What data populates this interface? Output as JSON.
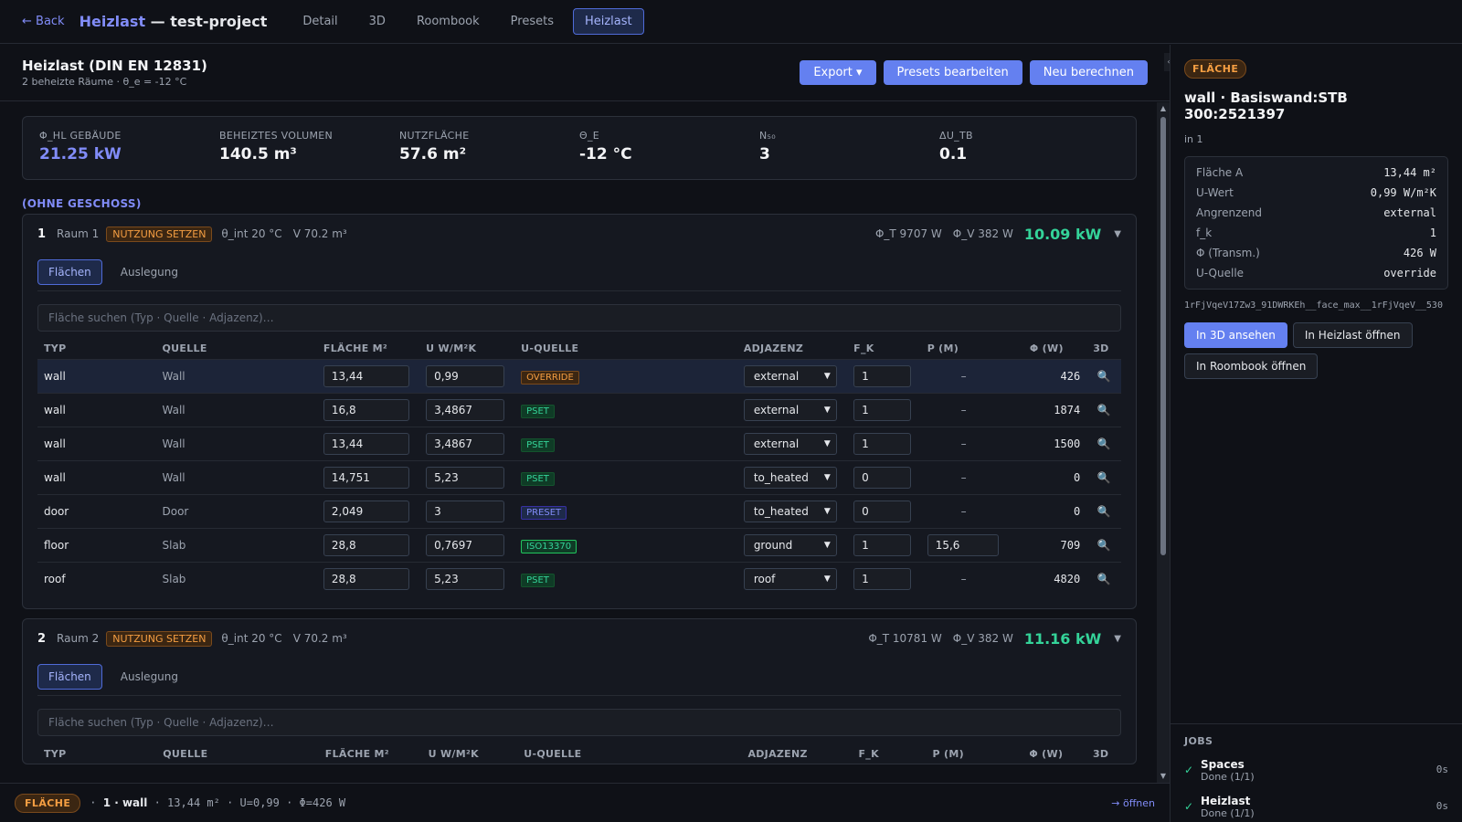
{
  "topbar": {
    "back": "← Back",
    "title_app": "Heizlast",
    "title_sep": " — test-project",
    "tabs": [
      "Detail",
      "3D",
      "Roombook",
      "Presets",
      "Heizlast"
    ],
    "active_tab": "Heizlast"
  },
  "header": {
    "title": "Heizlast (DIN EN 12831)",
    "subtitle": "2 beheizte Räume · θ_e = -12 °C",
    "buttons": {
      "export": "Export ▾",
      "presets": "Presets bearbeiten",
      "recalc": "Neu berechnen"
    }
  },
  "stats": [
    {
      "label": "Φ_HL GEBÄUDE",
      "value": "21.25 kW"
    },
    {
      "label": "BEHEIZTES VOLUMEN",
      "value": "140.5 m³"
    },
    {
      "label": "NUTZFLÄCHE",
      "value": "57.6 m²"
    },
    {
      "label": "Θ_E",
      "value": "-12 °C"
    },
    {
      "label": "N₅₀",
      "value": "3"
    },
    {
      "label": "ΔU_TB",
      "value": "0.1"
    }
  ],
  "section_title": "(OHNE GESCHOSS)",
  "columns": [
    "TYP",
    "QUELLE",
    "FLÄCHE M²",
    "U W/M²K",
    "U-QUELLE",
    "ADJAZENZ",
    "F_K",
    "P (M)",
    "Φ (W)",
    "3D"
  ],
  "rooms": [
    {
      "num": "1",
      "name": "Raum 1",
      "badge": "NUTZUNG SETZEN",
      "theta": "θ_int 20 °C",
      "volume": "V 70.2 m³",
      "phi_t": "Φ_T 9707 W",
      "phi_v": "Φ_V 382 W",
      "total": "10.09 kW",
      "tabs": [
        "Flächen",
        "Auslegung"
      ],
      "search_placeholder": "Fläche suchen (Typ · Quelle · Adjazenz)…",
      "rows": [
        {
          "typ": "wall",
          "quelle": "Wall",
          "flaeche": "13,44",
          "u": "0,99",
          "uquelle": "OVERRIDE",
          "adj": "external",
          "fk": "1",
          "p": "–",
          "phi": "426"
        },
        {
          "typ": "wall",
          "quelle": "Wall",
          "flaeche": "16,8",
          "u": "3,4867",
          "uquelle": "PSET",
          "adj": "external",
          "fk": "1",
          "p": "–",
          "phi": "1874"
        },
        {
          "typ": "wall",
          "quelle": "Wall",
          "flaeche": "13,44",
          "u": "3,4867",
          "uquelle": "PSET",
          "adj": "external",
          "fk": "1",
          "p": "–",
          "phi": "1500"
        },
        {
          "typ": "wall",
          "quelle": "Wall",
          "flaeche": "14,751",
          "u": "5,23",
          "uquelle": "PSET",
          "adj": "to_heated",
          "fk": "0",
          "p": "–",
          "phi": "0"
        },
        {
          "typ": "door",
          "quelle": "Door",
          "flaeche": "2,049",
          "u": "3",
          "uquelle": "PRESET",
          "adj": "to_heated",
          "fk": "0",
          "p": "–",
          "phi": "0"
        },
        {
          "typ": "floor",
          "quelle": "Slab",
          "flaeche": "28,8",
          "u": "0,7697",
          "uquelle": "ISO13370",
          "adj": "ground",
          "fk": "1",
          "p": "15,6",
          "phi": "709"
        },
        {
          "typ": "roof",
          "quelle": "Slab",
          "flaeche": "28,8",
          "u": "5,23",
          "uquelle": "PSET",
          "adj": "roof",
          "fk": "1",
          "p": "–",
          "phi": "4820"
        }
      ]
    },
    {
      "num": "2",
      "name": "Raum 2",
      "badge": "NUTZUNG SETZEN",
      "theta": "θ_int 20 °C",
      "volume": "V 70.2 m³",
      "phi_t": "Φ_T 10781 W",
      "phi_v": "Φ_V 382 W",
      "total": "11.16 kW",
      "tabs": [
        "Flächen",
        "Auslegung"
      ],
      "search_placeholder": "Fläche suchen (Typ · Quelle · Adjazenz)…"
    }
  ],
  "panel": {
    "badge": "FLÄCHE",
    "title": "wall · Basiswand:STB 300:2521397",
    "sub": "in 1",
    "kv": [
      {
        "k": "Fläche A",
        "v": "13,44 m²"
      },
      {
        "k": "U-Wert",
        "v": "0,99 W/m²K"
      },
      {
        "k": "Angrenzend",
        "v": "external"
      },
      {
        "k": "f_k",
        "v": "1"
      },
      {
        "k": "Φ (Transm.)",
        "v": "426 W"
      },
      {
        "k": "U-Quelle",
        "v": "override"
      }
    ],
    "guid": "1rFjVqeV17Zw3_91DWRKEh__face_max__1rFjVqeV__530",
    "btn_3d": "In 3D ansehen",
    "btn_heizlast": "In Heizlast öffnen",
    "btn_roombook": "In Roombook öffnen",
    "jobs_title": "JOBS",
    "jobs": [
      {
        "name": "Spaces",
        "status": "Done (1/1)",
        "time": "0s"
      },
      {
        "name": "Heizlast",
        "status": "Done (1/1)",
        "time": "0s"
      }
    ]
  },
  "statusbar": {
    "badge": "FLÄCHE",
    "label": "1 · wall",
    "detail": " · 13,44 m² · U=0,99 · Φ=426 W",
    "open": "→ öffnen"
  },
  "colors": {
    "accent": "#818cf8",
    "button": "#6480f0",
    "green": "#34d399",
    "orange": "#f59e42"
  }
}
